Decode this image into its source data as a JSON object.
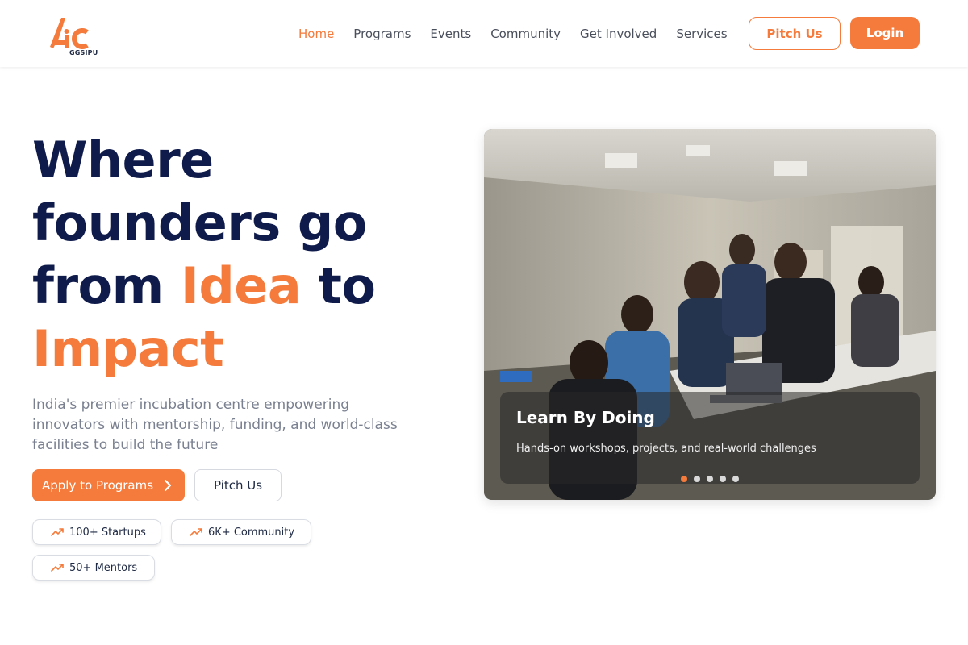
{
  "brand": {
    "logo_text": "GGSIPU",
    "accent_color": "#f47b3c",
    "navy_color": "#0f1b4b"
  },
  "nav": {
    "links": [
      "Home",
      "Programs",
      "Events",
      "Community",
      "Get Involved",
      "Services"
    ],
    "active": "Home",
    "pitch_label": "Pitch Us",
    "login_label": "Login"
  },
  "hero": {
    "title_line1": "Where",
    "title_line2": "founders go",
    "title_line3_prefix": "from",
    "title_idea": "Idea",
    "title_line3_suffix": "to",
    "title_impact": "Impact",
    "subtitle": "India's premier incubation centre empowering innovators with mentorship, funding, and world-class facilities to build the future",
    "apply_label": "Apply to Programs",
    "pitch_label": "Pitch Us",
    "stats": [
      "100+ Startups",
      "6K+ Community",
      "50+ Mentors"
    ]
  },
  "carousel": {
    "slide_title": "Learn By Doing",
    "slide_text": "Hands-on workshops, projects, and real-world challenges",
    "slide_count": 5,
    "active_index": 0
  },
  "icons": {
    "stat_icon": "trending-up-icon",
    "apply_icon": "chevron-right-icon"
  }
}
